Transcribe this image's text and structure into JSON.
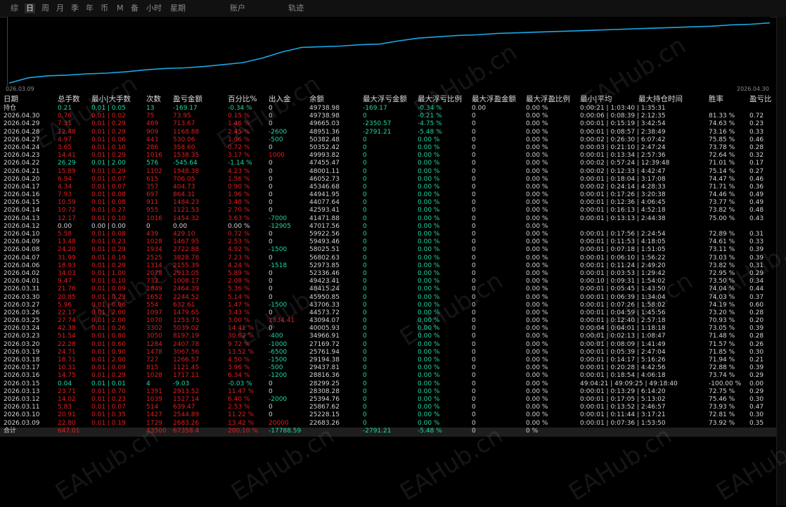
{
  "tabs": [
    {
      "label": "综",
      "active": false
    },
    {
      "label": "日",
      "active": true
    },
    {
      "label": "周",
      "active": false
    },
    {
      "label": "月",
      "active": false
    },
    {
      "label": "季",
      "active": false
    },
    {
      "label": "年",
      "active": false
    },
    {
      "label": "币",
      "active": false
    },
    {
      "label": "M",
      "active": false
    },
    {
      "label": "备",
      "active": false
    },
    {
      "label": "小时",
      "active": false
    },
    {
      "label": "星期",
      "active": false
    },
    {
      "label": "账户",
      "active": false
    },
    {
      "label": "轨迹",
      "active": false
    }
  ],
  "chart": {
    "x_start_label": "026.03.09",
    "x_end_label": "2026.04.30",
    "line_color": "#19a8e6",
    "curve_y": [
      0.02,
      0.1,
      0.13,
      0.14,
      0.16,
      0.17,
      0.19,
      0.22,
      0.24,
      0.25,
      0.27,
      0.3,
      0.33,
      0.4,
      0.49,
      0.56,
      0.57,
      0.58,
      0.6,
      0.61,
      0.66,
      0.7,
      0.72,
      0.74,
      0.75,
      0.77,
      0.78,
      0.79,
      0.8,
      0.81,
      0.82,
      0.83,
      0.84,
      0.85,
      0.86,
      0.87,
      0.88,
      0.9,
      0.91,
      0.93
    ]
  },
  "watermark": "EAHub.cn",
  "colors": {
    "green": "#1ed6a4",
    "red": "#e21d1d",
    "white": "#d4d4d4",
    "background": "#000000",
    "total_bg": "#1e1e1e"
  },
  "columns": [
    "日期",
    "总手数",
    "最小|大手数",
    "次数",
    "盈亏金额",
    "百分比%",
    "出入金",
    "余额",
    "最大浮亏金额",
    "最大浮亏比例",
    "最大浮盈金额",
    "最大浮盈比例",
    "最小|平均",
    "最大持仓时间",
    "胜率",
    "盈亏比"
  ],
  "rows": [
    {
      "c": "g",
      "d": [
        "持仓",
        "0.21",
        "0.01 | 0.05",
        "13",
        "-169.17",
        "-0.34 %",
        "0",
        "49738.98",
        "-169.17",
        "-0.34 %",
        "0.00",
        "0.00 %",
        "0:00:21 | 1:03:40 | 1:35:31",
        "",
        "",
        ""
      ]
    },
    {
      "c": "r",
      "d": [
        "2026.04.30",
        "0.76",
        "0.01 | 0.02",
        "75",
        "73.95",
        "0.15 %",
        "0",
        "49738.98",
        "0",
        "-0.21 %",
        "0",
        "0.00 %",
        "0:00:06 | 0:08:39 | 2:12:35",
        "",
        "81.33 %",
        "0.72"
      ]
    },
    {
      "c": "r",
      "d": [
        "2026.04.29",
        "7.31",
        "0.01 | 0.29",
        "469",
        "713.67",
        "1.46 %",
        "0",
        "49665.03",
        "-2350.57",
        "-4.75 %",
        "0",
        "0.00 %",
        "0:00:01 | 0:15:19 | 3:42:54",
        "",
        "74.63 %",
        "0.23"
      ]
    },
    {
      "c": "r",
      "d": [
        "2026.04.28",
        "12.48",
        "0.01 | 0.29",
        "909",
        "1168.88",
        "2.45 %",
        "-2600",
        "48951.36",
        "-2791.21",
        "-5.48 %",
        "0",
        "0.00 %",
        "0:00:01 | 0:08:57 | 2:38:49",
        "",
        "73.16 %",
        "0.33"
      ]
    },
    {
      "c": "r",
      "d": [
        "2026.04.27",
        "4.97",
        "0.01 | 0.06",
        "443",
        "530.06",
        "1.06 %",
        "-500",
        "50382.48",
        "0",
        "0.00 %",
        "0",
        "0.00 %",
        "0:00:02 | 0:26:30 | 6:07:42",
        "",
        "75.85 %",
        "0.46"
      ]
    },
    {
      "c": "r",
      "d": [
        "2026.04.24",
        "3.65",
        "0.01 | 0.10",
        "286",
        "358.60",
        "0.72 %",
        "0",
        "50352.42",
        "0",
        "0.00 %",
        "0",
        "0.00 %",
        "0:00:03 | 0:21:10 | 2:47:24",
        "",
        "73.78 %",
        "0.28"
      ]
    },
    {
      "c": "r",
      "d": [
        "2026.04.23",
        "14.41",
        "0.01 | 0.29",
        "1016",
        "1538.35",
        "3.17 %",
        "1000",
        "49993.82",
        "0",
        "0.00 %",
        "0",
        "0.00 %",
        "0:00:01 | 0:13:34 | 2:57:36",
        "",
        "72.64 %",
        "0.32"
      ]
    },
    {
      "c": "g",
      "d": [
        "2026.04.22",
        "26.29",
        "0.01 | 2.00",
        "576",
        "-545.64",
        "-1.14 %",
        "0",
        "47455.47",
        "0",
        "0.00 %",
        "0",
        "0.00 %",
        "0:00:02 | 0:57:24 | 12:39:48",
        "",
        "71.01 %",
        "0.17"
      ]
    },
    {
      "c": "r",
      "d": [
        "2026.04.21",
        "15.89",
        "0.01 | 0.29",
        "1102",
        "1948.38",
        "4.23 %",
        "0",
        "48001.11",
        "0",
        "0.00 %",
        "0",
        "0.00 %",
        "0:00:02 | 0:12:33 | 4:42:47",
        "",
        "75.14 %",
        "0.27"
      ]
    },
    {
      "c": "r",
      "d": [
        "2026.04.20",
        "6.94",
        "0.01 | 0.07",
        "615",
        "706.05",
        "1.56 %",
        "0",
        "46052.73",
        "0",
        "0.00 %",
        "0",
        "0.00 %",
        "0:00:01 | 0:18:04 | 3:17:08",
        "",
        "74.47 %",
        "0.46"
      ]
    },
    {
      "c": "r",
      "d": [
        "2026.04.17",
        "4.34",
        "0.01 | 0.07",
        "357",
        "404.73",
        "0.90 %",
        "0",
        "45346.68",
        "0",
        "0.00 %",
        "0",
        "0.00 %",
        "0:00:02 | 0:24:14 | 4:28:33",
        "",
        "71.71 %",
        "0.36"
      ]
    },
    {
      "c": "r",
      "d": [
        "2026.04.16",
        "7.93",
        "0.01 | 0.08",
        "697",
        "864.31",
        "1.96 %",
        "0",
        "44941.95",
        "0",
        "0.00 %",
        "0",
        "0.00 %",
        "0:00:01 | 0:17:26 | 3:20:38",
        "",
        "74.46 %",
        "0.49"
      ]
    },
    {
      "c": "r",
      "d": [
        "2026.04.15",
        "10.59",
        "0.01 | 0.08",
        "911",
        "1484.23",
        "3.48 %",
        "0",
        "44077.64",
        "0",
        "0.00 %",
        "0",
        "0.00 %",
        "0:00:01 | 0:12:36 | 4:06:45",
        "",
        "73.77 %",
        "0.49"
      ]
    },
    {
      "c": "r",
      "d": [
        "2026.04.14",
        "10.72",
        "0.01 | 0.27",
        "955",
        "1121.53",
        "2.70 %",
        "0",
        "42593.41",
        "0",
        "0.00 %",
        "0",
        "0.00 %",
        "0:00:01 | 0:16:13 | 4:52:18",
        "",
        "73.82 %",
        "0.48"
      ]
    },
    {
      "c": "r",
      "d": [
        "2026.04.13",
        "12.17",
        "0.01 | 0.10",
        "1016",
        "1454.32",
        "3.63 %",
        "-7000",
        "41471.88",
        "0",
        "0.00 %",
        "0",
        "0.00 %",
        "0:00:01 | 0:13:13 | 2:44:38",
        "",
        "75.00 %",
        "0.43"
      ]
    },
    {
      "c": "w",
      "d": [
        "2026.04.12",
        "0.00",
        "0.00 | 0.00",
        "0",
        "0.00",
        "0.00 %",
        "-12905",
        "47017.56",
        "0",
        "0.00 %",
        "0",
        "0.00 %",
        "",
        "",
        "",
        ""
      ]
    },
    {
      "c": "r",
      "d": [
        "2026.04.10",
        "5.58",
        "0.01 | 0.08",
        "439",
        "429.10",
        "0.72 %",
        "0",
        "59922.56",
        "0",
        "0.00 %",
        "0",
        "0.00 %",
        "0:00:01 | 0:17:56 | 2:24:54",
        "",
        "72.89 %",
        "0.31"
      ]
    },
    {
      "c": "r",
      "d": [
        "2026.04.09",
        "13.48",
        "0.01 | 0.23",
        "1028",
        "1467.95",
        "2.53 %",
        "0",
        "59493.46",
        "0",
        "0.00 %",
        "0",
        "0.00 %",
        "0:00:01 | 0:11:53 | 4:18:05",
        "",
        "74.61 %",
        "0.33"
      ]
    },
    {
      "c": "r",
      "d": [
        "2026.04.08",
        "24.20",
        "0.01 | 0.29",
        "1934",
        "2722.88",
        "4.92 %",
        "-1500",
        "58025.51",
        "0",
        "0.00 %",
        "0",
        "0.00 %",
        "0:00:01 | 0:07:18 | 1:51:05",
        "",
        "73.11 %",
        "0.39"
      ]
    },
    {
      "c": "r",
      "d": [
        "2026.04.07",
        "31.99",
        "0.01 | 0.19",
        "2525",
        "3828.78",
        "7.23 %",
        "0",
        "56802.63",
        "0",
        "0.00 %",
        "0",
        "0.00 %",
        "0:00:01 | 0:06:10 | 1:56:22",
        "",
        "73.03 %",
        "0.39"
      ]
    },
    {
      "c": "r",
      "d": [
        "2026.04.06",
        "18.93",
        "0.01 | 0.29",
        "1314",
        "2155.39",
        "4.24 %",
        "-1518",
        "52973.85",
        "0",
        "0.00 %",
        "0",
        "0.00 %",
        "0:00:01 | 0:11:24 | 2:49:20",
        "",
        "73.82 %",
        "0.31"
      ]
    },
    {
      "c": "r",
      "d": [
        "2026.04.02",
        "34.03",
        "0.01 | 1.00",
        "2078",
        "2913.05",
        "5.89 %",
        "0",
        "52336.46",
        "0",
        "0.00 %",
        "0",
        "0.00 %",
        "0:00:01 | 0:03:53 | 1:29:42",
        "",
        "72.95 %",
        "0.29"
      ]
    },
    {
      "c": "r",
      "d": [
        "2026.04.01",
        "9.47",
        "0.01 | 0.10",
        "732",
        "1008.17",
        "2.08 %",
        "0",
        "49423.41",
        "0",
        "0.00 %",
        "0",
        "0.00 %",
        "0:00:10 | 0:09:31 | 1:54:02",
        "",
        "73.50 %",
        "0.34"
      ]
    },
    {
      "c": "r",
      "d": [
        "2026.03.31",
        "21.76",
        "0.01 | 0.09",
        "1849",
        "2464.39",
        "5.36 %",
        "0",
        "48415.24",
        "0",
        "0.00 %",
        "0",
        "0.00 %",
        "0:00:01 | 0:05:45 | 1:43:50",
        "",
        "74.04 %",
        "0.44"
      ]
    },
    {
      "c": "r",
      "d": [
        "2026.03.30",
        "20.85",
        "0.01 | 0.23",
        "1652",
        "2244.52",
        "5.14 %",
        "0",
        "45950.85",
        "0",
        "0.00 %",
        "0",
        "0.00 %",
        "0:00:01 | 0:06:39 | 1:34:04",
        "",
        "74.03 %",
        "0.37"
      ]
    },
    {
      "c": "r",
      "d": [
        "2026.03.27",
        "5.96",
        "0.01 | 0.06",
        "554",
        "632.61",
        "1.47 %",
        "-1500",
        "43706.33",
        "0",
        "0.00 %",
        "0",
        "0.00 %",
        "0:00:01 | 0:07:26 | 1:58:02",
        "",
        "74.19 %",
        "0.60"
      ]
    },
    {
      "c": "r",
      "d": [
        "2026.03.26",
        "22.17",
        "0.01 | 2.00",
        "1097",
        "1479.65",
        "3.43 %",
        "0",
        "44573.72",
        "0",
        "0.00 %",
        "0",
        "0.00 %",
        "0:00:01 | 0:04:59 | 1:45:56",
        "",
        "73.20 %",
        "0.28"
      ]
    },
    {
      "c": "r",
      "d": [
        "2026.03.25",
        "27.74",
        "0.01 | 2.00",
        "1070",
        "1253.73",
        "3.00 %",
        "1834.41",
        "43094.07",
        "0",
        "0.00 %",
        "0",
        "0.00 %",
        "0:00:01 | 0:12:40 | 2:57:18",
        "",
        "70.93 %",
        "0.20"
      ]
    },
    {
      "c": "r",
      "d": [
        "2026.03.24",
        "42.38",
        "0.01 | 0.26",
        "3302",
        "5039.02",
        "14.41 %",
        "0",
        "40005.93",
        "0",
        "0.00 %",
        "0",
        "0.00 %",
        "0:00:04 | 0:04:01 | 1:18:18",
        "",
        "73.05 %",
        "0.39"
      ]
    },
    {
      "c": "r",
      "d": [
        "2026.03.23",
        "51.54",
        "0.01 | 0.80",
        "3050",
        "8197.19",
        "30.62 %",
        "-400",
        "34966.91",
        "0",
        "0.00 %",
        "0",
        "0.00 %",
        "0:00:01 | 0:02:13 | 1:08:47",
        "",
        "71.48 %",
        "0.28"
      ]
    },
    {
      "c": "r",
      "d": [
        "2026.03.20",
        "22.28",
        "0.01 | 0.60",
        "1284",
        "2407.78",
        "9.72 %",
        "-1000",
        "27169.72",
        "0",
        "0.00 %",
        "0",
        "0.00 %",
        "0:00:01 | 0:08:09 | 1:41:49",
        "",
        "71.57 %",
        "0.26"
      ]
    },
    {
      "c": "r",
      "d": [
        "2026.03.19",
        "24.71",
        "0.01 | 0.90",
        "1478",
        "3067.56",
        "13.52 %",
        "-6500",
        "25761.94",
        "0",
        "0.00 %",
        "0",
        "0.00 %",
        "0:00:01 | 0:05:39 | 2:47:04",
        "",
        "71.85 %",
        "0.30"
      ]
    },
    {
      "c": "r",
      "d": [
        "2026.03.18",
        "18.71",
        "0.01 | 2.00",
        "727",
        "1266.57",
        "4.50 %",
        "-1500",
        "29194.38",
        "0",
        "0.00 %",
        "0",
        "0.00 %",
        "0:00:01 | 0:14:17 | 5:16:26",
        "",
        "71.94 %",
        "0.21"
      ]
    },
    {
      "c": "r",
      "d": [
        "2026.03.17",
        "10.31",
        "0.01 | 0.09",
        "815",
        "1121.45",
        "3.96 %",
        "-500",
        "29437.81",
        "0",
        "0.00 %",
        "0",
        "0.00 %",
        "0:00:01 | 0:20:28 | 4:42:56",
        "",
        "72.88 %",
        "0.39"
      ]
    },
    {
      "c": "r",
      "d": [
        "2026.03.16",
        "14.75",
        "0.01 | 0.29",
        "1028",
        "1717.11",
        "6.34 %",
        "-1200",
        "28816.36",
        "0",
        "0.00 %",
        "0",
        "0.00 %",
        "0:00:01 | 0:18:54 | 4:06:18",
        "",
        "73.74 %",
        "0.29"
      ]
    },
    {
      "c": "g",
      "d": [
        "2026.03.15",
        "0.04",
        "0.01 | 0.01",
        "4",
        "-9.03",
        "-0.03 %",
        "0",
        "28299.25",
        "0",
        "0.00 %",
        "0",
        "0.00 %",
        "49:04:21 | 49:09:25 | 49:18:40",
        "",
        "-100.00 %",
        "0.00"
      ]
    },
    {
      "c": "r",
      "d": [
        "2026.03.13",
        "23.71",
        "0.01 | 0.70",
        "1391",
        "2913.52",
        "11.47 %",
        "0",
        "28308.28",
        "0",
        "0.00 %",
        "0",
        "0.00 %",
        "0:00:01 | 0:13:29 | 6:14:20",
        "",
        "72.75 %",
        "0.29"
      ]
    },
    {
      "c": "r",
      "d": [
        "2026.03.12",
        "14.02",
        "0.01 | 0.23",
        "1039",
        "1527.14",
        "6.40 %",
        "-2000",
        "25394.76",
        "0",
        "0.00 %",
        "0",
        "0.00 %",
        "0:00:01 | 0:17:05 | 5:13:02",
        "",
        "75.46 %",
        "0.30"
      ]
    },
    {
      "c": "r",
      "d": [
        "2026.03.11",
        "5.83",
        "0.01 | 0.07",
        "514",
        "639.47",
        "2.53 %",
        "0",
        "25867.62",
        "0",
        "0.00 %",
        "0",
        "0.00 %",
        "0:00:01 | 0:13:52 | 2:46:57",
        "",
        "73.93 %",
        "0.47"
      ]
    },
    {
      "c": "r",
      "d": [
        "2026.03.10",
        "20.91",
        "0.01 | 0.35",
        "1427",
        "2544.89",
        "11.22 %",
        "0",
        "25228.15",
        "0",
        "0.00 %",
        "0",
        "0.00 %",
        "0:00:01 | 0:11:44 | 3:17:21",
        "",
        "72.81 %",
        "0.30"
      ]
    },
    {
      "c": "r",
      "d": [
        "2026.03.09",
        "22.80",
        "0.01 | 0.19",
        "1729",
        "2683.26",
        "13.42 %",
        "20000",
        "22683.26",
        "0",
        "0.00 %",
        "0",
        "0.00 %",
        "0:00:01 | 0:07:36 | 1:53:50",
        "",
        "73.92 %",
        "0.35"
      ]
    }
  ],
  "total": {
    "label": "合计",
    "lots": "647.01",
    "count": "43500",
    "pnl": "67358.4",
    "percent": "200.10 %",
    "deposit": "-17788.59",
    "max_float_loss": "-2791.21",
    "max_float_loss_pct": "-5.48 %",
    "max_float_profit": "0",
    "max_float_profit_pct": "0 %"
  }
}
